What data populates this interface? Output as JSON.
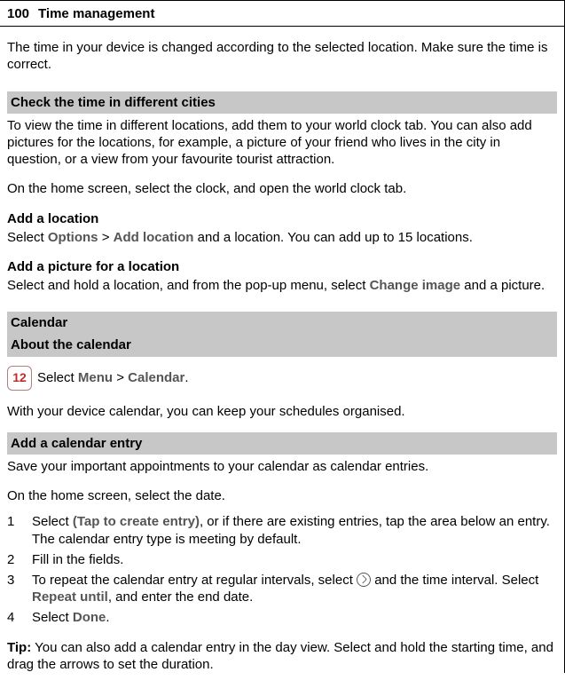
{
  "header": {
    "page_number": "100",
    "chapter": "Time management"
  },
  "intro": "The time in your device is changed according to the selected location. Make sure the time is correct.",
  "check_cities": {
    "title": "Check the time in different cities",
    "p1": "To view the time in different locations, add them to your world clock tab. You can also add pictures for the locations, for example, a picture of your friend who lives in the city in question, or a view from your favourite tourist attraction.",
    "p2": "On the home screen, select the clock, and open the world clock tab.",
    "add_loc_head": "Add a location",
    "add_loc_pre": "Select ",
    "add_loc_options": "Options",
    "add_loc_sep": " > ",
    "add_loc_addloc": "Add location",
    "add_loc_post": " and a location. You can add up to 15 locations.",
    "add_pic_head": "Add a picture for a location",
    "add_pic_pre": "Select and hold a location, and from the pop-up menu, select ",
    "add_pic_change": "Change image",
    "add_pic_post": " and a picture."
  },
  "calendar": {
    "bar": "Calendar",
    "about_bar": "About the calendar",
    "icon_text": "12",
    "select_pre": "Select ",
    "menu": "Menu",
    "sep": " > ",
    "cal": "Calendar",
    "select_post": ".",
    "p": "With your device calendar, you can keep your schedules organised."
  },
  "entry": {
    "bar": "Add a calendar entry",
    "p1": "Save your important appointments to your calendar as calendar entries.",
    "p2": "On the home screen, select the date.",
    "steps": {
      "s1_pre": "Select ",
      "s1_bold": "(Tap to create entry)",
      "s1_post": ", or if there are existing entries, tap the area below an entry. The calendar entry type is meeting by default.",
      "s2": "Fill in the fields.",
      "s3_pre": "To repeat the calendar entry at regular intervals, select ",
      "s3_mid": " and the time interval. Select ",
      "s3_bold": "Repeat until",
      "s3_post": ", and enter the end date.",
      "s4_pre": "Select ",
      "s4_bold": "Done",
      "s4_post": "."
    },
    "tip_label": "Tip:",
    "tip_text": " You can also add a calendar entry in the day view. Select and hold the starting time, and drag the arrows to set the duration."
  }
}
